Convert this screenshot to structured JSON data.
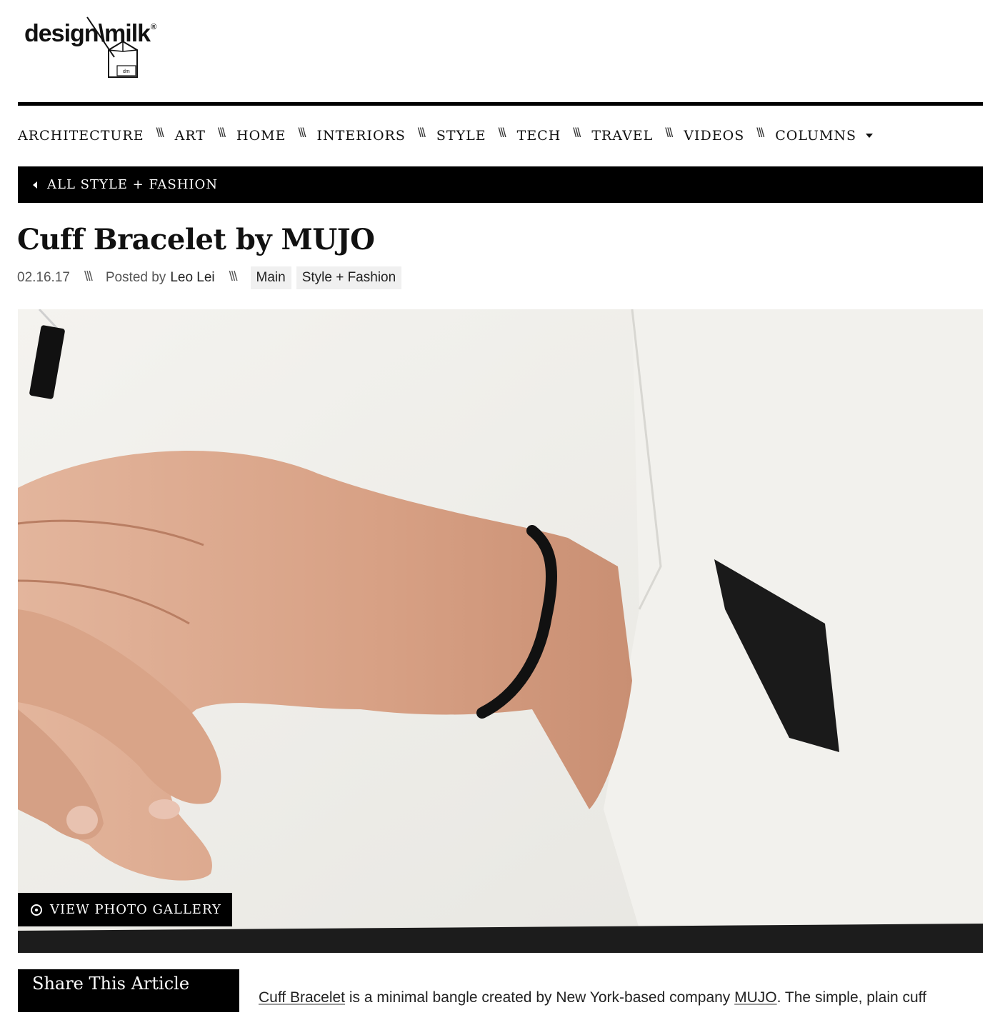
{
  "logo": {
    "text": "design\\milk",
    "reg_mark": "®",
    "carton_label": "dm"
  },
  "nav": {
    "items": [
      {
        "label": "ARCHITECTURE"
      },
      {
        "label": "ART"
      },
      {
        "label": "HOME"
      },
      {
        "label": "INTERIORS"
      },
      {
        "label": "STYLE"
      },
      {
        "label": "TECH"
      },
      {
        "label": "TRAVEL"
      },
      {
        "label": "VIDEOS"
      },
      {
        "label": "COLUMNS"
      }
    ],
    "separator": "\\\\\\"
  },
  "back_link": {
    "label": "ALL STYLE + FASHION",
    "icon": "triangle-left-icon"
  },
  "article": {
    "title": "Cuff Bracelet by MUJO",
    "date": "02.16.17",
    "posted_by_prefix": "Posted by",
    "author": "Leo Lei",
    "tags": [
      "Main",
      "Style + Fashion"
    ],
    "separator": "\\\\\\"
  },
  "hero": {
    "gallery_button": "VIEW PHOTO GALLERY",
    "gallery_icon": "circle-dot-icon",
    "colors": {
      "sweater": "#f1f0ec",
      "skin": "#d9a489",
      "bracelet": "#151515"
    }
  },
  "share": {
    "title": "Share This Article"
  },
  "body": {
    "link1": "Cuff Bracelet",
    "text1": " is a minimal bangle created by New York-based company ",
    "link2": "MUJO",
    "text2": ". The simple, plain cuff"
  }
}
